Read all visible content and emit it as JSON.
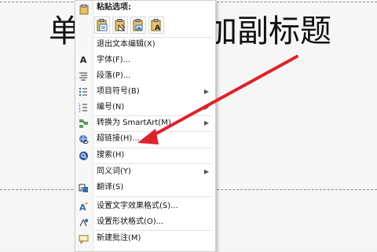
{
  "slide": {
    "title_left": "单",
    "title_right": "加副标题"
  },
  "context_menu": {
    "paste_header": "粘贴选项:",
    "paste_buttons": [
      "keep-source-formatting-icon",
      "use-destination-theme-icon",
      "picture-icon",
      "text-only-icon"
    ],
    "items": [
      {
        "label": "退出文本编辑(X)",
        "icon": "",
        "submenu": false
      },
      {
        "label": "字体(F)...",
        "icon": "font-icon",
        "submenu": false
      },
      {
        "label": "段落(P)...",
        "icon": "paragraph-icon",
        "submenu": false
      },
      {
        "label": "项目符号(B)",
        "icon": "bullets-icon",
        "submenu": true
      },
      {
        "label": "编号(N)",
        "icon": "numbering-icon",
        "submenu": true
      },
      {
        "label": "转换为 SmartArt(M)",
        "icon": "smartart-icon",
        "submenu": true
      },
      {
        "label": "超链接(H)...",
        "icon": "hyperlink-icon",
        "submenu": false
      },
      {
        "label": "搜索(H)",
        "icon": "search-icon",
        "submenu": false
      },
      {
        "label": "同义词(Y)",
        "icon": "",
        "submenu": true
      },
      {
        "label": "翻译(S)",
        "icon": "translate-icon",
        "submenu": false
      },
      {
        "label": "设置文字效果格式(S)...",
        "icon": "text-effects-icon",
        "submenu": false
      },
      {
        "label": "设置形状格式(O)...",
        "icon": "shape-format-icon",
        "submenu": false
      },
      {
        "label": "新建批注(M)",
        "icon": "comment-icon",
        "submenu": false
      }
    ]
  },
  "colors": {
    "arrow": "#e0202a",
    "accent_blue": "#2f6db5"
  }
}
